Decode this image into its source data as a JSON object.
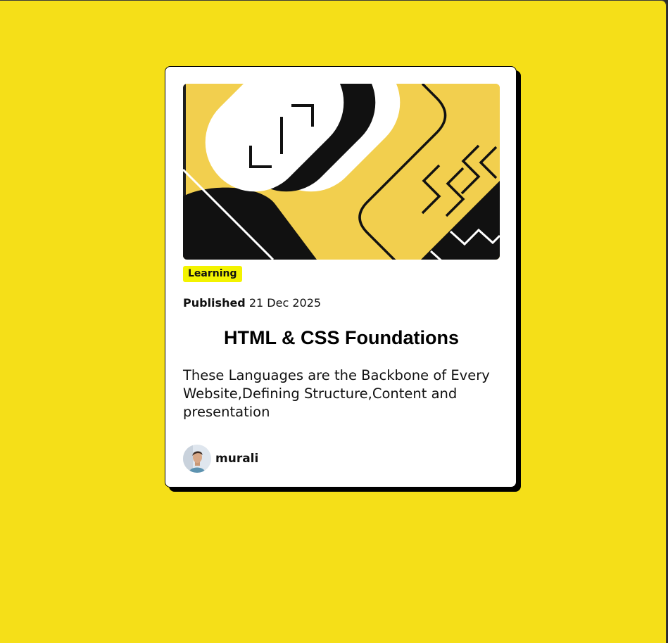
{
  "colors": {
    "background": "#f5df18",
    "card": "#ffffff",
    "tag_background": "#f3f300",
    "hero_yellow": "#f2cf4e"
  },
  "card": {
    "hero_image": "html-css-illustration",
    "category": "Learning",
    "published_label": "Published",
    "published_date": "21 Dec 2025",
    "title": "HTML & CSS Foundations",
    "description": "These Languages are the Backbone of Every Website,Defining Structure,Content and presentation",
    "author": {
      "avatar": "author-avatar",
      "name": "murali"
    }
  }
}
